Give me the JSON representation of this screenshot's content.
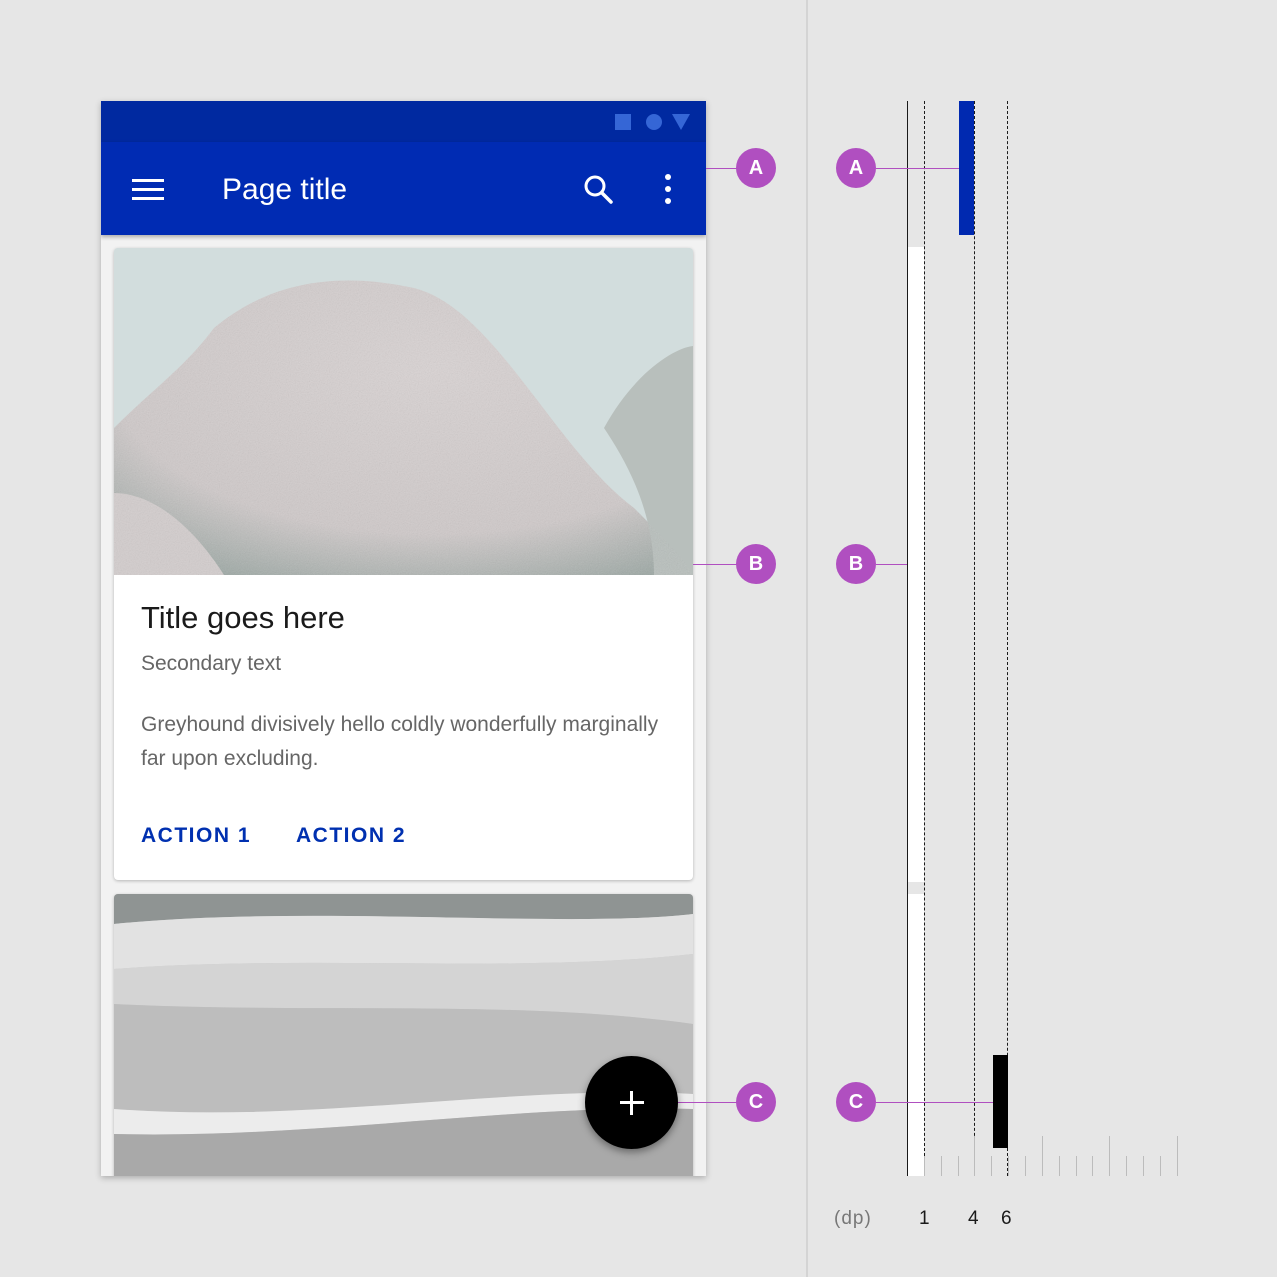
{
  "phone": {
    "status_icons": [
      "square-icon",
      "circle-icon",
      "triangle-icon"
    ],
    "app_bar": {
      "title": "Page title",
      "nav_icon": "menu-icon",
      "action_icons": [
        "search-icon",
        "more-vert-icon"
      ],
      "color": "#002bb3",
      "status_color": "#0029a0"
    },
    "card1": {
      "image": "granite boulders against pale sky",
      "title": "Title goes here",
      "secondary": "Secondary text",
      "body": "Greyhound divisively hello coldly wonderfully marginally far upon excluding.",
      "actions": [
        "ACTION 1",
        "ACTION 2"
      ],
      "action_color": "#0030b0"
    },
    "card2": {
      "image": "white sand dunes"
    },
    "fab": {
      "icon": "plus-icon",
      "color": "#000000"
    }
  },
  "callouts": {
    "color": "#b04fc0",
    "labels": [
      "A",
      "B",
      "C"
    ]
  },
  "elevation_diagram": {
    "unit": "(dp)",
    "tick_labels": [
      "1",
      "4",
      "6"
    ],
    "components": [
      {
        "label": "A",
        "name": "Top app bar",
        "elevation_dp": 4,
        "color": "#0029b0"
      },
      {
        "label": "B",
        "name": "Card",
        "elevation_dp": 1,
        "color": "#ffffff"
      },
      {
        "label": "C",
        "name": "FAB",
        "elevation_dp": 6,
        "color": "#000000"
      }
    ]
  }
}
